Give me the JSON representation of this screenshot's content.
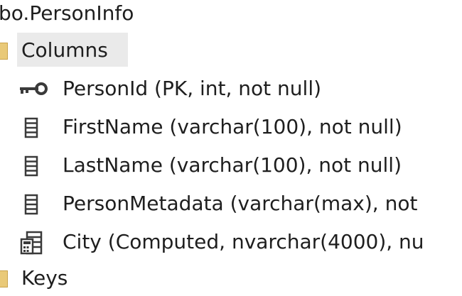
{
  "tree": {
    "table_node_label": "bo.PersonInfo",
    "columns_folder_label": "Columns",
    "columns": [
      {
        "label": "PersonId (PK, int, not null)",
        "icon": "primary-key-icon"
      },
      {
        "label": "FirstName (varchar(100), not null)",
        "icon": "column-icon"
      },
      {
        "label": "LastName (varchar(100), not null)",
        "icon": "column-icon"
      },
      {
        "label": "PersonMetadata (varchar(max), not",
        "icon": "column-icon"
      },
      {
        "label": "City (Computed, nvarchar(4000), nu",
        "icon": "computed-column-icon"
      }
    ],
    "keys_folder_label": "Keys"
  },
  "colors": {
    "folder": "#e9c978",
    "selection": "#eaeaea",
    "icon": "#3a3a3a"
  }
}
